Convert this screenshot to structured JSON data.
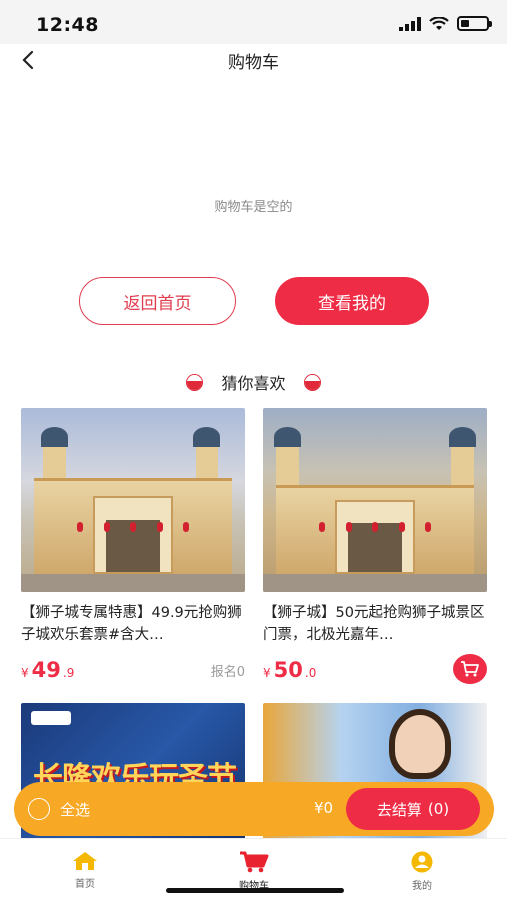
{
  "status_bar": {
    "time": "12:48",
    "battery_level": 0.35
  },
  "nav": {
    "title": "购物车",
    "back_icon": "chevron-left-icon"
  },
  "cart": {
    "empty_message": "购物车是空的"
  },
  "actions": {
    "home_label": "返回首页",
    "mine_label": "查看我的"
  },
  "recommend": {
    "title": "猜你喜欢"
  },
  "products": [
    {
      "title": "【狮子城专属特惠】49.9元抢购狮子城欢乐套票#含大…",
      "currency": "¥",
      "price_int": "49",
      "price_dec": ".9",
      "sold": "报名0"
    },
    {
      "title": "【狮子城】50元起抢购狮子城景区门票，北极光嘉年…",
      "currency": "¥",
      "price_int": "50",
      "price_dec": ".0",
      "cart_icon": "cart-icon"
    },
    {
      "poster_text": "长隆欢乐玩圣节"
    },
    {
      "image": "photo"
    }
  ],
  "checkout": {
    "select_all_label": "全选",
    "total": "¥0",
    "settle_label": "去结算",
    "settle_count": "(0)"
  },
  "tabs": [
    {
      "label": "首页",
      "icon": "home-icon",
      "active": false,
      "color": "#f5b800"
    },
    {
      "label": "购物车",
      "icon": "cart-icon",
      "active": true,
      "color": "#e8232f"
    },
    {
      "label": "我的",
      "icon": "user-icon",
      "active": false,
      "color": "#f5b800"
    }
  ],
  "colors": {
    "accent": "#ef2c45",
    "checkout_bar": "#f7a825"
  }
}
